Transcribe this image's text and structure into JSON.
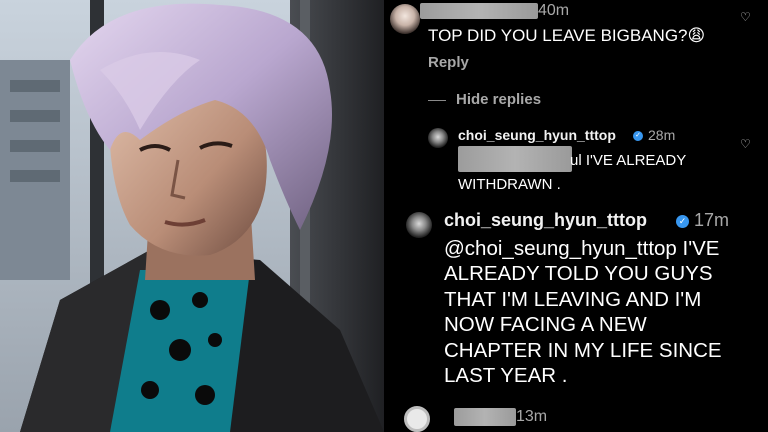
{
  "comment_1": {
    "time": "40m",
    "text": "TOP DID YOU LEAVE BIGBANG?😩",
    "reply_label": "Reply"
  },
  "hide_replies_label": "Hide replies",
  "reply_1": {
    "username": "choi_seung_hyun_tttop",
    "time": "28m",
    "text_line1": "ul I'VE ALREADY",
    "text_line2": "WITHDRAWN ."
  },
  "reply_2": {
    "username": "choi_seung_hyun_tttop",
    "time": "17m",
    "lines": [
      "@choi_seung_hyun_tttop I'VE",
      "ALREADY TOLD YOU GUYS",
      "THAT I'M LEAVING AND I'M",
      "NOW FACING A NEW",
      "CHAPTER IN MY LIFE SINCE",
      "LAST YEAR ."
    ]
  },
  "comment_next": {
    "time": "13m"
  },
  "icons": {
    "heart": "heart-icon",
    "verified": "verified-badge-icon"
  },
  "colors": {
    "background": "#000000",
    "verified": "#3897f0",
    "secondary_text": "#a8a8a8"
  }
}
